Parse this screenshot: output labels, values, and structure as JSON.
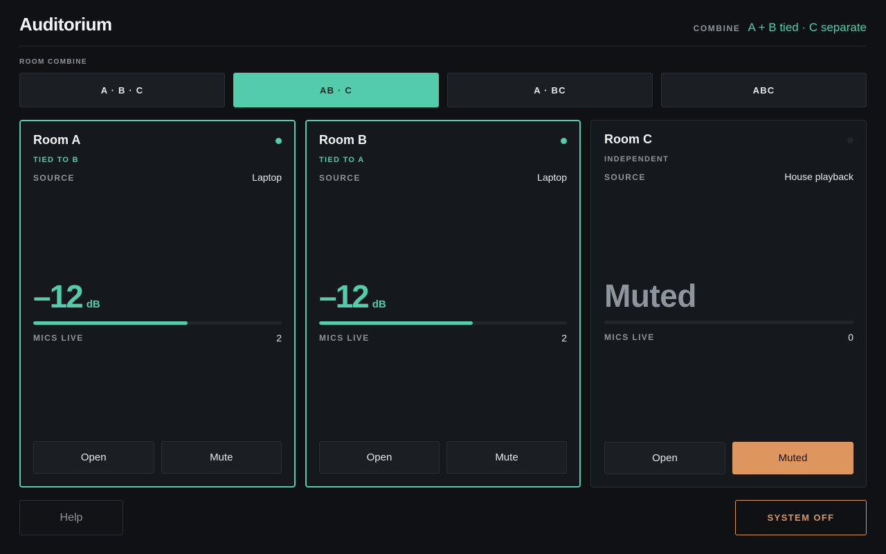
{
  "header": {
    "title": "Auditorium",
    "combine_label": "COMBINE",
    "combine_value": "A + B tied · C separate"
  },
  "room_combine": {
    "label": "ROOM COMBINE",
    "modes": [
      "A · B · C",
      "AB · C",
      "A · BC",
      "ABC"
    ],
    "active": "AB · C"
  },
  "rooms": [
    {
      "name": "Room A",
      "status": "live",
      "tie": "TIED TO B",
      "source_label": "SOURCE",
      "source": "Laptop",
      "level": "–12",
      "level_unit": "dB",
      "level_fraction": 0.62,
      "mics_label": "MICS LIVE",
      "mics_live": "2",
      "open_label": "Open",
      "mute_label": "Mute"
    },
    {
      "name": "Room B",
      "status": "live",
      "tie": "TIED TO A",
      "source_label": "SOURCE",
      "source": "Laptop",
      "level": "–12",
      "level_unit": "dB",
      "level_fraction": 0.62,
      "mics_label": "MICS LIVE",
      "mics_live": "2",
      "open_label": "Open",
      "mute_label": "Mute"
    },
    {
      "name": "Room C",
      "status": "off",
      "tie": "INDEPENDENT",
      "source_label": "SOURCE",
      "source": "House playback",
      "muted_text": "Muted",
      "level_fraction": 0,
      "mics_label": "MICS LIVE",
      "mics_live": "0",
      "open_label": "Open",
      "mute_label": "Muted"
    }
  ],
  "footer": {
    "help_label": "Help",
    "system_off_label": "SYSTEM OFF"
  },
  "colors": {
    "accent": "#52ccab",
    "warning": "#dd975e",
    "background": "#0f1114"
  }
}
